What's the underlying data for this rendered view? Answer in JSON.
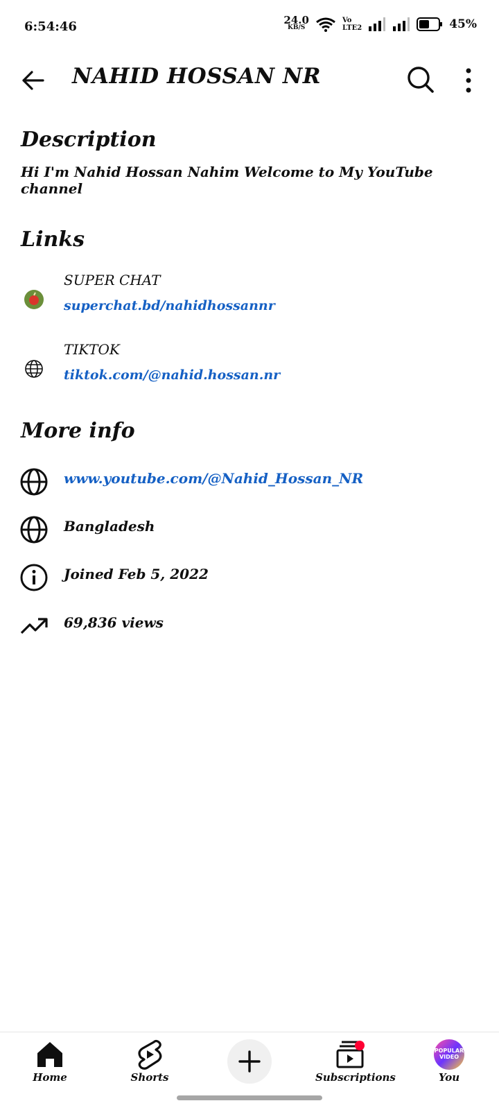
{
  "status_bar": {
    "time": "6:54:46",
    "speed_value": "24.0",
    "speed_unit": "KB/S",
    "vo_label": "Vo",
    "lte_label": "LTE2",
    "battery": "45%"
  },
  "header": {
    "title": "NAHID HOSSAN NR"
  },
  "description": {
    "heading": "Description",
    "text": "Hi I'm Nahid Hossan Nahim Welcome to My YouTube channel"
  },
  "links": {
    "heading": "Links",
    "items": [
      {
        "title": "SUPER CHAT",
        "url": "superchat.bd/nahidhossannr",
        "icon": "superchat-icon"
      },
      {
        "title": "TIKTOK",
        "url": "tiktok.com/@nahid.hossan.nr",
        "icon": "globe-icon"
      }
    ]
  },
  "more_info": {
    "heading": "More info",
    "channel_url": "www.youtube.com/@Nahid_Hossan_NR",
    "country": "Bangladesh",
    "joined": "Joined Feb 5, 2022",
    "views": "69,836 views"
  },
  "bottom_nav": {
    "home": "Home",
    "shorts": "Shorts",
    "subscriptions": "Subscriptions",
    "you": "You",
    "you_avatar_text": "POPULAR VIDEO"
  }
}
